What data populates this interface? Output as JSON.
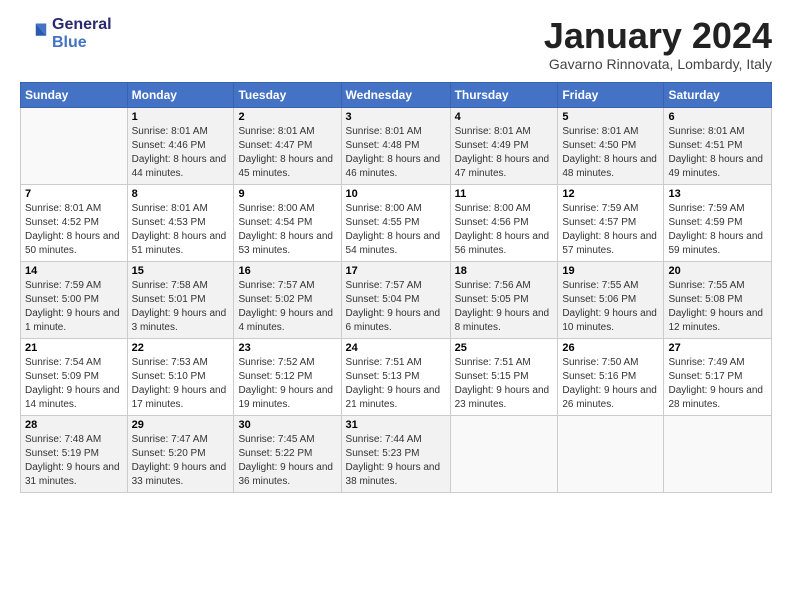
{
  "header": {
    "logo_line1": "General",
    "logo_line2": "Blue",
    "title": "January 2024",
    "subtitle": "Gavarno Rinnovata, Lombardy, Italy"
  },
  "days_of_week": [
    "Sunday",
    "Monday",
    "Tuesday",
    "Wednesday",
    "Thursday",
    "Friday",
    "Saturday"
  ],
  "weeks": [
    [
      {
        "day": "",
        "sunrise": "",
        "sunset": "",
        "daylight": ""
      },
      {
        "day": "1",
        "sunrise": "8:01 AM",
        "sunset": "4:46 PM",
        "daylight": "8 hours and 44 minutes."
      },
      {
        "day": "2",
        "sunrise": "8:01 AM",
        "sunset": "4:47 PM",
        "daylight": "8 hours and 45 minutes."
      },
      {
        "day": "3",
        "sunrise": "8:01 AM",
        "sunset": "4:48 PM",
        "daylight": "8 hours and 46 minutes."
      },
      {
        "day": "4",
        "sunrise": "8:01 AM",
        "sunset": "4:49 PM",
        "daylight": "8 hours and 47 minutes."
      },
      {
        "day": "5",
        "sunrise": "8:01 AM",
        "sunset": "4:50 PM",
        "daylight": "8 hours and 48 minutes."
      },
      {
        "day": "6",
        "sunrise": "8:01 AM",
        "sunset": "4:51 PM",
        "daylight": "8 hours and 49 minutes."
      }
    ],
    [
      {
        "day": "7",
        "sunrise": "8:01 AM",
        "sunset": "4:52 PM",
        "daylight": "8 hours and 50 minutes."
      },
      {
        "day": "8",
        "sunrise": "8:01 AM",
        "sunset": "4:53 PM",
        "daylight": "8 hours and 51 minutes."
      },
      {
        "day": "9",
        "sunrise": "8:00 AM",
        "sunset": "4:54 PM",
        "daylight": "8 hours and 53 minutes."
      },
      {
        "day": "10",
        "sunrise": "8:00 AM",
        "sunset": "4:55 PM",
        "daylight": "8 hours and 54 minutes."
      },
      {
        "day": "11",
        "sunrise": "8:00 AM",
        "sunset": "4:56 PM",
        "daylight": "8 hours and 56 minutes."
      },
      {
        "day": "12",
        "sunrise": "7:59 AM",
        "sunset": "4:57 PM",
        "daylight": "8 hours and 57 minutes."
      },
      {
        "day": "13",
        "sunrise": "7:59 AM",
        "sunset": "4:59 PM",
        "daylight": "8 hours and 59 minutes."
      }
    ],
    [
      {
        "day": "14",
        "sunrise": "7:59 AM",
        "sunset": "5:00 PM",
        "daylight": "9 hours and 1 minute."
      },
      {
        "day": "15",
        "sunrise": "7:58 AM",
        "sunset": "5:01 PM",
        "daylight": "9 hours and 3 minutes."
      },
      {
        "day": "16",
        "sunrise": "7:57 AM",
        "sunset": "5:02 PM",
        "daylight": "9 hours and 4 minutes."
      },
      {
        "day": "17",
        "sunrise": "7:57 AM",
        "sunset": "5:04 PM",
        "daylight": "9 hours and 6 minutes."
      },
      {
        "day": "18",
        "sunrise": "7:56 AM",
        "sunset": "5:05 PM",
        "daylight": "9 hours and 8 minutes."
      },
      {
        "day": "19",
        "sunrise": "7:55 AM",
        "sunset": "5:06 PM",
        "daylight": "9 hours and 10 minutes."
      },
      {
        "day": "20",
        "sunrise": "7:55 AM",
        "sunset": "5:08 PM",
        "daylight": "9 hours and 12 minutes."
      }
    ],
    [
      {
        "day": "21",
        "sunrise": "7:54 AM",
        "sunset": "5:09 PM",
        "daylight": "9 hours and 14 minutes."
      },
      {
        "day": "22",
        "sunrise": "7:53 AM",
        "sunset": "5:10 PM",
        "daylight": "9 hours and 17 minutes."
      },
      {
        "day": "23",
        "sunrise": "7:52 AM",
        "sunset": "5:12 PM",
        "daylight": "9 hours and 19 minutes."
      },
      {
        "day": "24",
        "sunrise": "7:51 AM",
        "sunset": "5:13 PM",
        "daylight": "9 hours and 21 minutes."
      },
      {
        "day": "25",
        "sunrise": "7:51 AM",
        "sunset": "5:15 PM",
        "daylight": "9 hours and 23 minutes."
      },
      {
        "day": "26",
        "sunrise": "7:50 AM",
        "sunset": "5:16 PM",
        "daylight": "9 hours and 26 minutes."
      },
      {
        "day": "27",
        "sunrise": "7:49 AM",
        "sunset": "5:17 PM",
        "daylight": "9 hours and 28 minutes."
      }
    ],
    [
      {
        "day": "28",
        "sunrise": "7:48 AM",
        "sunset": "5:19 PM",
        "daylight": "9 hours and 31 minutes."
      },
      {
        "day": "29",
        "sunrise": "7:47 AM",
        "sunset": "5:20 PM",
        "daylight": "9 hours and 33 minutes."
      },
      {
        "day": "30",
        "sunrise": "7:45 AM",
        "sunset": "5:22 PM",
        "daylight": "9 hours and 36 minutes."
      },
      {
        "day": "31",
        "sunrise": "7:44 AM",
        "sunset": "5:23 PM",
        "daylight": "9 hours and 38 minutes."
      },
      {
        "day": "",
        "sunrise": "",
        "sunset": "",
        "daylight": ""
      },
      {
        "day": "",
        "sunrise": "",
        "sunset": "",
        "daylight": ""
      },
      {
        "day": "",
        "sunrise": "",
        "sunset": "",
        "daylight": ""
      }
    ]
  ]
}
